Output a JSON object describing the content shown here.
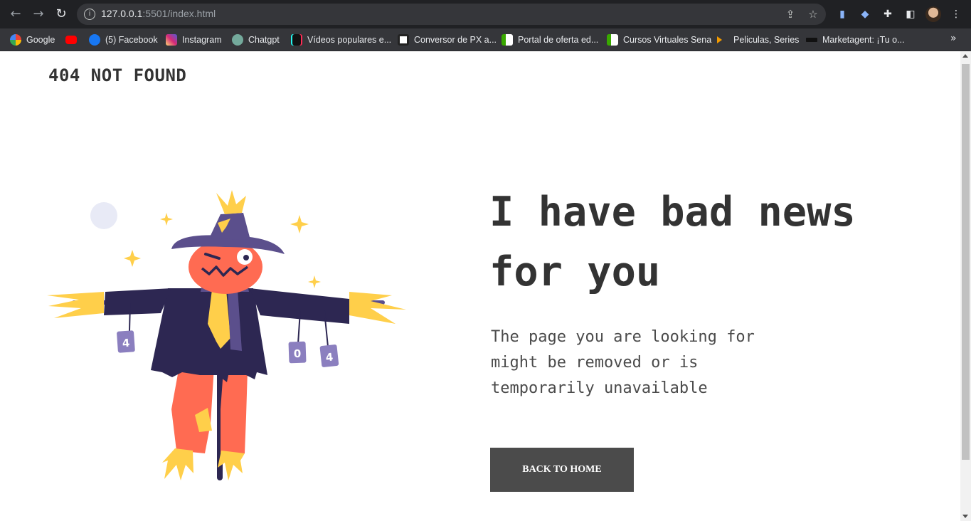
{
  "browser": {
    "url_host": "127.0.0.1",
    "url_rest": ":5501/index.html",
    "bookmarks": [
      {
        "label": "Google",
        "color": "#ffffff"
      },
      {
        "label": "",
        "color": "#ff0000"
      },
      {
        "label": "(5) Facebook",
        "color": "#1877f2"
      },
      {
        "label": "Instagram",
        "color": "#d62976"
      },
      {
        "label": "Chatgpt",
        "color": "#74aa9c"
      },
      {
        "label": "Vídeos populares e...",
        "color": "#111111"
      },
      {
        "label": "Conversor de PX a...",
        "color": "#ffffff"
      },
      {
        "label": "Portal de oferta ed...",
        "color": "#ffffff"
      },
      {
        "label": "Cursos Virtuales Sena",
        "color": "#ffffff"
      },
      {
        "label": "Peliculas, Series",
        "color": "#f29a00"
      },
      {
        "label": "Marketagent: ¡Tu o...",
        "color": "#222222"
      }
    ]
  },
  "page": {
    "logo": "404 NOT FOUND",
    "headline": "I have bad news for you",
    "message": "The page you are looking for might be removed or is temporarily unavailable",
    "button_label": "BACK TO HOME",
    "cans": [
      "4",
      "0",
      "4"
    ]
  },
  "colors": {
    "text_dark": "#333333",
    "button_bg": "#4b4b4b",
    "coat": "#2d2752",
    "hat": "#5b4f8c",
    "face": "#ff6b52",
    "straw": "#ffcf4a"
  }
}
